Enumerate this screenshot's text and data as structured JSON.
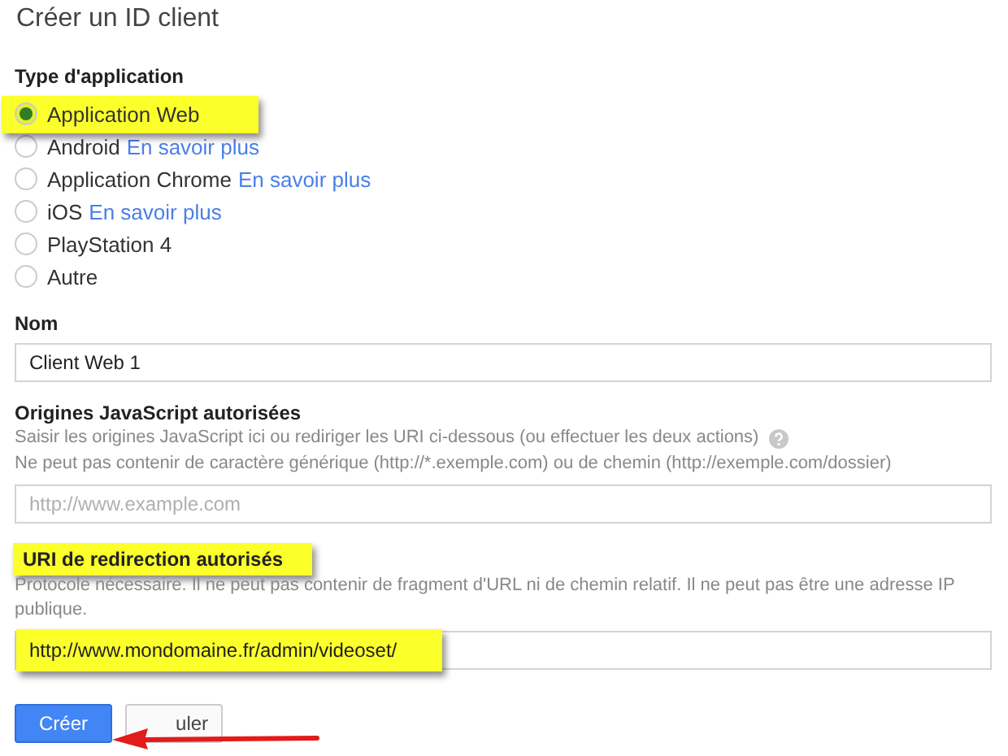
{
  "title": "Créer un ID client",
  "app_type": {
    "label": "Type d'application",
    "options": [
      {
        "label": "Application Web",
        "selected": true,
        "highlighted": true
      },
      {
        "label": "Android",
        "link": "En savoir plus",
        "selected": false,
        "highlighted": false
      },
      {
        "label": "Application Chrome",
        "link": "En savoir plus",
        "selected": false,
        "highlighted": false
      },
      {
        "label": "iOS",
        "link": "En savoir plus",
        "selected": false,
        "highlighted": false
      },
      {
        "label": "PlayStation 4",
        "selected": false,
        "highlighted": false
      },
      {
        "label": "Autre",
        "selected": false,
        "highlighted": false
      }
    ]
  },
  "fields": [
    {
      "label": "Nom",
      "label_highlighted": false,
      "value": "Client Web 1",
      "value_highlighted": false
    },
    {
      "label": "Origines JavaScript autorisées",
      "label_highlighted": false,
      "help": [
        "Saisir les origines JavaScript ici ou rediriger les URI ci-dessous (ou effectuer les deux actions)",
        "Ne peut pas contenir de caractère générique (http://*.exemple.com) ou de chemin (http://exemple.com/dossier)"
      ],
      "help_icon": true,
      "placeholder": "http://www.example.com"
    },
    {
      "label": "URI de redirection autorisés",
      "label_highlighted": true,
      "help": [
        "Protocole nécessaire. Il ne peut pas contenir de fragment d'URL ni de chemin relatif. Il ne peut pas être une adresse IP publique."
      ],
      "value": "http://www.mondomaine.fr/admin/videoset/",
      "value_highlighted": true
    }
  ],
  "buttons": [
    {
      "label": "Créer",
      "kind": "primary"
    },
    {
      "label": "uler",
      "kind": "secondary"
    }
  ],
  "annotation": {
    "kind": "arrow"
  }
}
